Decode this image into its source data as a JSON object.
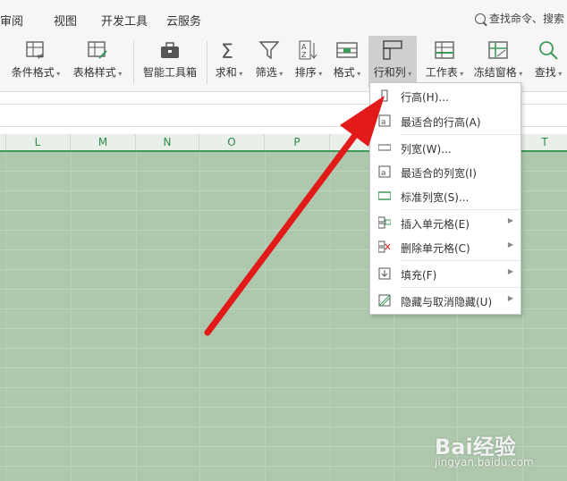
{
  "tabs": [
    "审阅",
    "视图",
    "开发工具",
    "云服务"
  ],
  "search": {
    "label": "查找命令、搜索"
  },
  "ribbon": {
    "conditional_format": "条件格式",
    "table_style": "表格样式",
    "smart_toolbox": "智能工具箱",
    "sum": "求和",
    "filter": "筛选",
    "sort": "排序",
    "format": "格式",
    "row_col": "行和列",
    "worksheet": "工作表",
    "freeze": "冻结窗格",
    "find": "查找"
  },
  "columns": [
    "L",
    "M",
    "N",
    "O",
    "P",
    "T"
  ],
  "menu": {
    "row_height": "行高(H)...",
    "best_row_height": "最适合的行高(A)",
    "col_width": "列宽(W)...",
    "best_col_width": "最适合的列宽(I)",
    "std_col_width": "标准列宽(S)...",
    "insert_cells": "插入单元格(E)",
    "delete_cells": "删除单元格(C)",
    "fill": "填充(F)",
    "hide_unhide": "隐藏与取消隐藏(U)"
  },
  "watermark": {
    "brand": "Bai经验",
    "url": "jingyan.baidu.com"
  },
  "colors": {
    "accent_green": "#3d9a5a",
    "grid_fill": "#adc8ad",
    "arrow_red": "#e21a1a"
  }
}
